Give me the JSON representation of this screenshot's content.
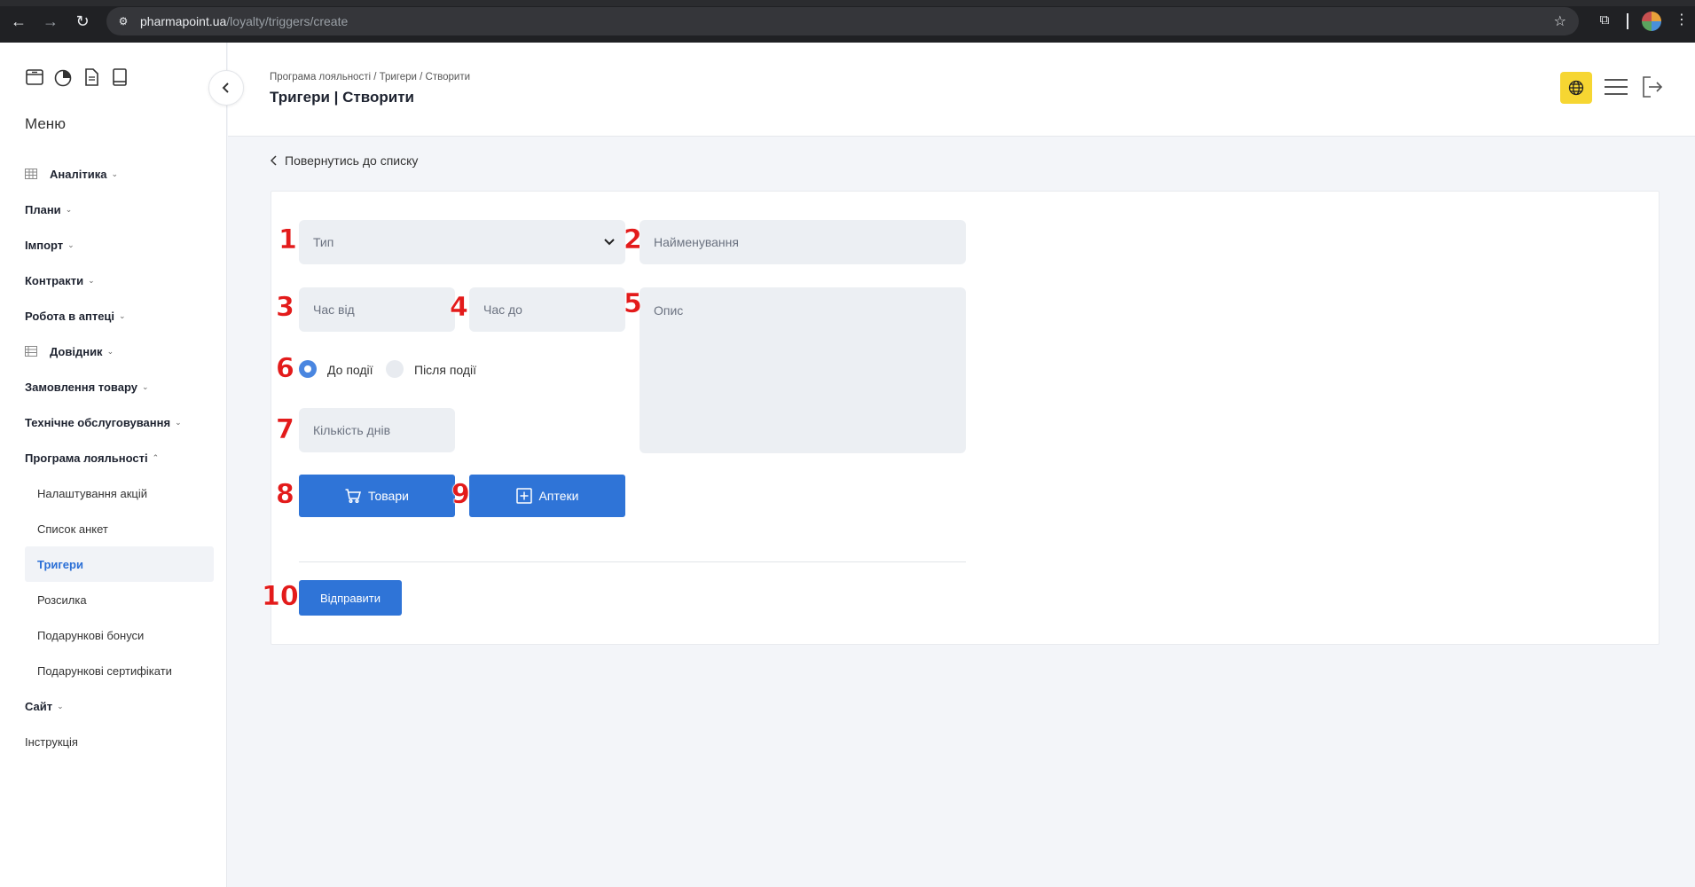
{
  "browser": {
    "url_host": "pharmapoint.ua",
    "url_path": "/loyalty/triggers/create"
  },
  "sidebar": {
    "menu_title": "Меню",
    "items": [
      {
        "label": "Аналітика",
        "has_icon": true,
        "expanded": false
      },
      {
        "label": "Плани",
        "has_icon": false,
        "expanded": false
      },
      {
        "label": "Імпорт",
        "has_icon": false,
        "expanded": false
      },
      {
        "label": "Контракти",
        "has_icon": false,
        "expanded": false
      },
      {
        "label": "Робота в аптеці",
        "has_icon": false,
        "expanded": false
      },
      {
        "label": "Довідник",
        "has_icon": true,
        "expanded": false
      },
      {
        "label": "Замовлення товару",
        "has_icon": false,
        "expanded": false
      },
      {
        "label": "Технічне обслуговування",
        "has_icon": false,
        "expanded": false
      },
      {
        "label": "Програма лояльності",
        "has_icon": false,
        "expanded": true
      }
    ],
    "subitems": [
      {
        "label": "Налаштування акцій",
        "active": false
      },
      {
        "label": "Список анкет",
        "active": false
      },
      {
        "label": "Тригери",
        "active": true
      },
      {
        "label": "Розсилка",
        "active": false
      },
      {
        "label": "Подарункові бонуси",
        "active": false
      },
      {
        "label": "Подарункові сертифікати",
        "active": false
      }
    ],
    "after": [
      {
        "label": "Сайт",
        "caret": true
      },
      {
        "label": "Інструкція",
        "caret": false
      }
    ]
  },
  "header": {
    "breadcrumb": "Програма лояльності / Тригери / Створити",
    "title": "Тригери | Створити"
  },
  "content": {
    "back_label": "Повернутись до списку",
    "form": {
      "type_placeholder": "Тип",
      "name_placeholder": "Найменування",
      "time_from_placeholder": "Час від",
      "time_to_placeholder": "Час до",
      "description_placeholder": "Опис",
      "radio_before": "До події",
      "radio_after": "Після події",
      "selected_radio": "before",
      "days_placeholder": "Кількість днів",
      "goods_button": "Товари",
      "pharmacies_button": "Аптеки",
      "submit_button": "Відправити"
    },
    "annotations": [
      "1",
      "2",
      "3",
      "4",
      "5",
      "6",
      "7",
      "8",
      "9",
      "10"
    ]
  },
  "colors": {
    "primary": "#2f74d7",
    "accent_yellow": "#f6d632",
    "annotation_red": "#e31b1b",
    "field_bg": "#eceff3"
  }
}
